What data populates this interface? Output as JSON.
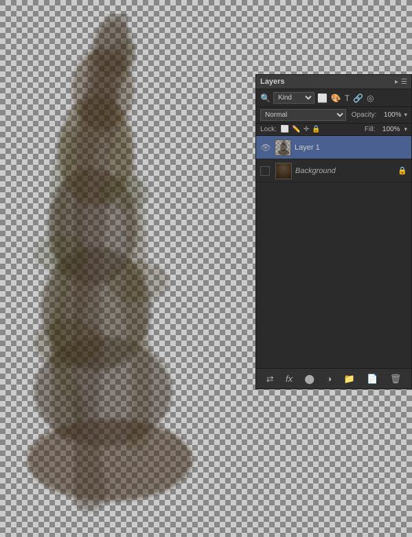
{
  "panel": {
    "title": "Layers",
    "filter_label": "Kind",
    "blend_mode": "Normal",
    "opacity_label": "Opacity:",
    "opacity_value": "100%",
    "lock_label": "Lock:",
    "fill_label": "Fill:",
    "fill_value": "100%",
    "header_icons": [
      "▸",
      "☰"
    ]
  },
  "layers": [
    {
      "id": "layer1",
      "name": "Layer 1",
      "visible": true,
      "active": true,
      "italic": false,
      "locked": false,
      "thumb_type": "transparent"
    },
    {
      "id": "background",
      "name": "Background",
      "visible": false,
      "active": false,
      "italic": true,
      "locked": true,
      "thumb_type": "dark"
    }
  ],
  "bottom_toolbar": {
    "icons": [
      "⇄",
      "fx",
      "●",
      "◎",
      "☰",
      "🗂",
      "🗑"
    ]
  },
  "filter_icons": [
    "⬜",
    "📷",
    "⬤",
    "T",
    "🔗",
    "◎"
  ]
}
